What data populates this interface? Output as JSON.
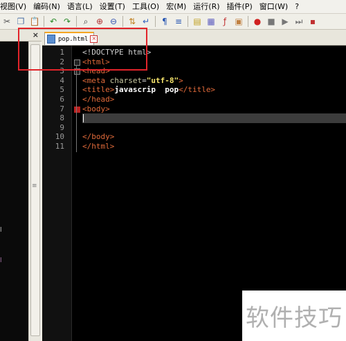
{
  "menu": [
    "视图(V)",
    "编码(N)",
    "语言(L)",
    "设置(T)",
    "工具(O)",
    "宏(M)",
    "运行(R)",
    "插件(P)",
    "窗口(W)",
    "?"
  ],
  "toolbar_icons": [
    "cut-icon",
    "copy-icon",
    "paste-icon",
    "sep",
    "undo-icon",
    "redo-icon",
    "sep",
    "find-icon",
    "zoom-in-icon",
    "zoom-out-icon",
    "sep",
    "sync-icon",
    "wrap-icon",
    "sep",
    "all-chars-icon",
    "indent-guide-icon",
    "sep",
    "lang-icon",
    "doc-map-icon",
    "func-list-icon",
    "folder-icon",
    "sep",
    "record-icon",
    "stop-icon",
    "play-icon",
    "play-multi-icon",
    "save-macro-icon"
  ],
  "left_panel": {
    "close_label": "×",
    "marks": [
      "l",
      "l"
    ]
  },
  "tab": {
    "label": "pop.html",
    "close_label": "×"
  },
  "editor": {
    "line_numbers": [
      "1",
      "2",
      "3",
      "4",
      "5",
      "6",
      "7",
      "8",
      "9",
      "10",
      "11"
    ],
    "current_line": 8,
    "lines": [
      [
        {
          "t": "doc",
          "s": "<!DOCTYPE html>"
        }
      ],
      [
        {
          "t": "tag",
          "s": "<html>"
        }
      ],
      [
        {
          "t": "tag",
          "s": "<head>"
        }
      ],
      [
        {
          "t": "tag",
          "s": "<meta "
        },
        {
          "t": "attr",
          "s": "charset"
        },
        {
          "t": "doc",
          "s": "="
        },
        {
          "t": "val",
          "s": "\"utf-8\""
        },
        {
          "t": "tag",
          "s": ">"
        }
      ],
      [
        {
          "t": "tag",
          "s": "<title>"
        },
        {
          "t": "txt",
          "s": "javascrip  pop"
        },
        {
          "t": "tag",
          "s": "</title>"
        }
      ],
      [
        {
          "t": "tag",
          "s": "</head>"
        }
      ],
      [
        {
          "t": "tag",
          "s": "<body>"
        }
      ],
      [],
      [],
      [
        {
          "t": "tag",
          "s": "</body>"
        }
      ],
      [
        {
          "t": "tag",
          "s": "</html>"
        }
      ]
    ]
  },
  "watermark": "软件技巧"
}
